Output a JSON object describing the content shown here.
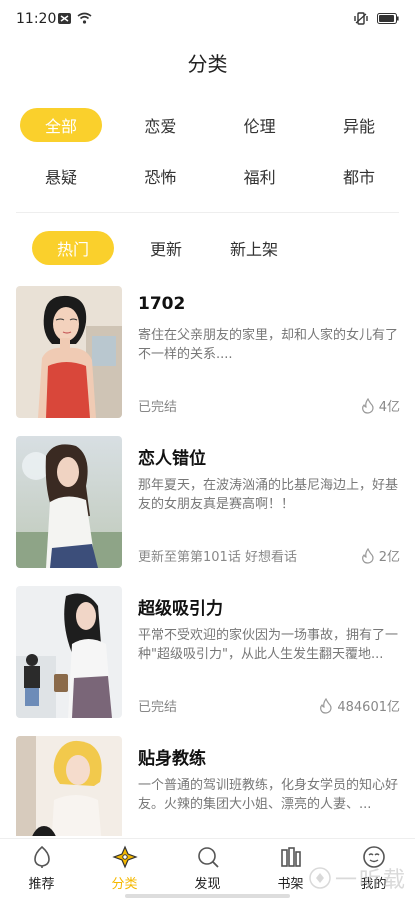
{
  "status_bar": {
    "time": "11:20"
  },
  "page": {
    "title": "分类"
  },
  "categories": [
    [
      {
        "label": "全部",
        "active": true
      },
      {
        "label": "恋爱"
      },
      {
        "label": "伦理"
      },
      {
        "label": "异能"
      }
    ],
    [
      {
        "label": "悬疑"
      },
      {
        "label": "恐怖"
      },
      {
        "label": "福利"
      },
      {
        "label": "都市"
      }
    ]
  ],
  "sort_tabs": [
    {
      "label": "热门",
      "active": true
    },
    {
      "label": "更新"
    },
    {
      "label": "新上架"
    }
  ],
  "comics": [
    {
      "title": "1702",
      "desc": "寄住在父亲朋友的家里，却和人家的女儿有了不一样的关系....",
      "status": "已完结",
      "heat": "4亿"
    },
    {
      "title": "恋人错位",
      "desc": "那年夏天，在波涛汹涌的比基尼海边上，好基友的女朋友真是赛高啊！！",
      "status": "更新至第第101话 好想看话",
      "heat": "2亿"
    },
    {
      "title": "超级吸引力",
      "desc": "平常不受欢迎的家伙因为一场事故，拥有了一种\"超级吸引力\"，从此人生发生翻天覆地...",
      "status": "已完结",
      "heat": "484601亿"
    },
    {
      "title": "贴身教练",
      "desc": "一个普通的驾训班教练，化身女学员的知心好友。火辣的集团大小姐、漂亮的人妻、...",
      "status": "",
      "heat": ""
    }
  ],
  "tabbar": [
    {
      "label": "推荐",
      "icon": "recommend-icon"
    },
    {
      "label": "分类",
      "icon": "category-icon",
      "active": true
    },
    {
      "label": "发现",
      "icon": "discover-icon"
    },
    {
      "label": "书架",
      "icon": "bookshelf-icon"
    },
    {
      "label": "我的",
      "icon": "profile-icon"
    }
  ],
  "watermark": {
    "text": "一听载"
  },
  "colors": {
    "accent": "#FAD02C",
    "active_tab": "#F5B800"
  }
}
